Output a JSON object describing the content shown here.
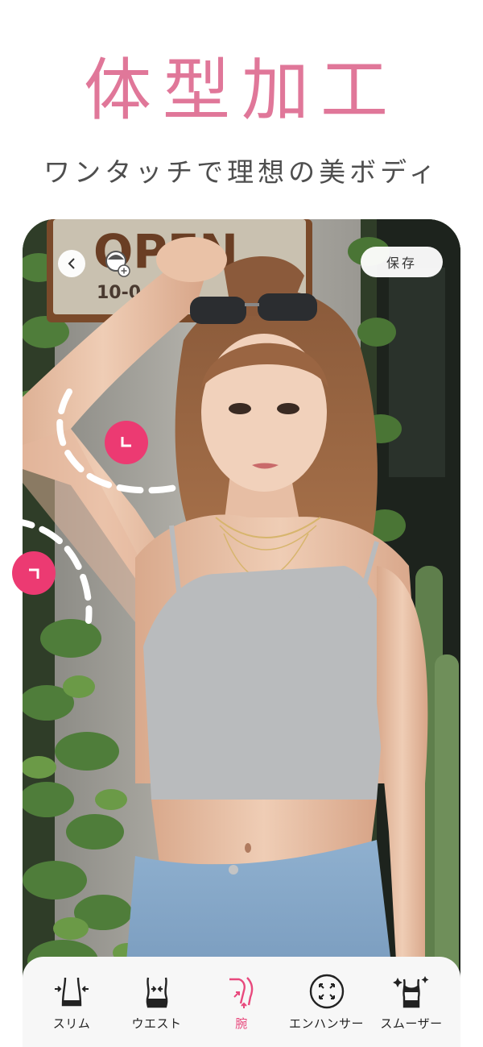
{
  "promo": {
    "headline": "体型加工",
    "subline": "ワンタッチで理想の美ボディ"
  },
  "photo_scene": {
    "sign_text": "OPEN",
    "sign_subtext": "10-0"
  },
  "editor": {
    "back_icon": "chevron-left-icon",
    "face_icon": "face-add-icon",
    "save_label": "保存"
  },
  "markers": [
    {
      "id": "upper",
      "icon": "corner-down-right-icon"
    },
    {
      "id": "lower",
      "icon": "corner-up-left-icon"
    }
  ],
  "toolbar": {
    "tools": [
      {
        "label": "スリム",
        "icon": "slim-body-icon",
        "active": false
      },
      {
        "label": "ウエスト",
        "icon": "waist-icon",
        "active": false
      },
      {
        "label": "腕",
        "icon": "arm-icon",
        "active": true
      },
      {
        "label": "エンハンサー",
        "icon": "enhancer-icon",
        "active": false
      },
      {
        "label": "スムーザー",
        "icon": "smoother-icon",
        "active": false
      }
    ]
  },
  "colors": {
    "accent_pink": "#e07799",
    "marker_pink": "#ec3a72",
    "active_tool": "#e8497d",
    "toolbar_bg": "#f7f7f7"
  }
}
